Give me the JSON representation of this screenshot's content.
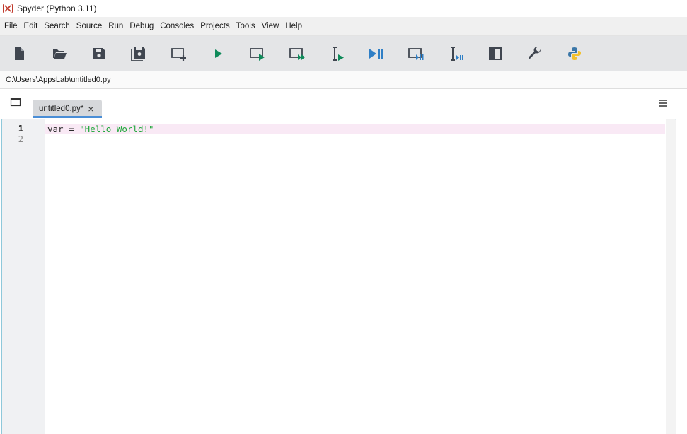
{
  "window": {
    "title": "Spyder (Python 3.11)"
  },
  "menu": [
    "File",
    "Edit",
    "Search",
    "Source",
    "Run",
    "Debug",
    "Consoles",
    "Projects",
    "Tools",
    "View",
    "Help"
  ],
  "toolbar": {
    "buttons": [
      "new-file",
      "open-file",
      "save-file",
      "save-all",
      "new-cell",
      "run",
      "run-cell",
      "run-cell-advance",
      "run-selection",
      "debug",
      "debug-cell",
      "debug-selection",
      "maximize-pane",
      "preferences",
      "pythonpath-manager"
    ]
  },
  "path": {
    "text": "C:\\Users\\AppsLab\\untitled0.py"
  },
  "tabs": [
    {
      "label": "untitled0.py*",
      "close": "×",
      "active": true
    }
  ],
  "editor": {
    "line_numbers": [
      "1",
      "2"
    ],
    "code": {
      "var": "var",
      "op": " = ",
      "string": "\"Hello World!\""
    }
  },
  "colors": {
    "accent": "#4a8ed6",
    "run_green": "#0f8a5a",
    "debug_blue": "#2f7fc6",
    "icon_dark": "#404650",
    "string_green": "#1fa73a",
    "current_line": "#f9e9f5"
  }
}
